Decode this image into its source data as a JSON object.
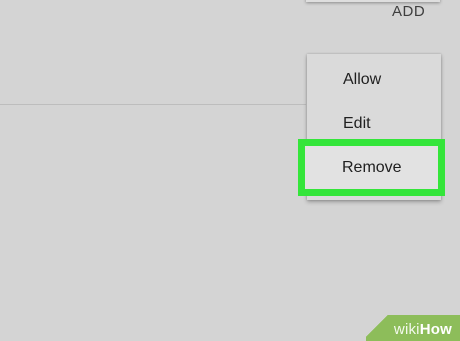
{
  "header": {
    "add_label": "ADD"
  },
  "context_menu": {
    "items": [
      {
        "label": "Allow"
      },
      {
        "label": "Edit"
      },
      {
        "label": "Remove"
      }
    ],
    "highlight_color": "#34e53a"
  },
  "watermark": {
    "part1": "wiki",
    "part2": "How",
    "color": "#8dbd5a"
  }
}
